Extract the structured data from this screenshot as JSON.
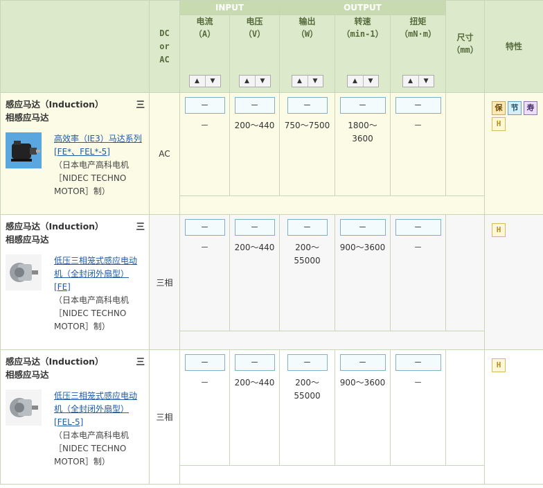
{
  "header": {
    "dc_ac": [
      "DC",
      "or",
      "AC"
    ],
    "input_group": "INPUT",
    "output_group": "OUTPUT",
    "columns": [
      {
        "name": "电流",
        "unit": "（A）"
      },
      {
        "name": "电压",
        "unit": "（V）"
      },
      {
        "name": "输出",
        "unit": "（W）"
      },
      {
        "name": "转速",
        "unit": "（min-1）"
      },
      {
        "name": "扭矩",
        "unit": "（mN·m）"
      }
    ],
    "size": {
      "name": "尺寸",
      "unit": "（mm）"
    },
    "features": "特性",
    "sort_up": "▲",
    "sort_down": "▼"
  },
  "rows": [
    {
      "category_a": "感应马达（Induction）",
      "category_b": "三",
      "category_c": "相感应马达",
      "product_link": "高效率（IE3）马达系列",
      "model_link": "[FE*、FEL*-5]",
      "maker": "（日本电产高科电机［NIDEC TECHNO MOTOR］制）",
      "dc_ac": "AC",
      "box": "－",
      "current": "－",
      "voltage": "200～440",
      "output": "750～7500",
      "speed": "1800～3600",
      "torque": "－",
      "badges": [
        "保",
        "节",
        "寿",
        "H"
      ]
    },
    {
      "category_a": "感应马达（Induction）",
      "category_b": "三",
      "category_c": "相感应马达",
      "product_link": "低压三相笼式感应电动机（全封闭外扇型）",
      "model_link": "[FE]",
      "maker": "（日本电产高科电机［NIDEC TECHNO MOTOR］制）",
      "dc_ac": "三相",
      "box": "－",
      "current": "－",
      "voltage": "200～440",
      "output": "200～55000",
      "speed": "900～3600",
      "torque": "－",
      "badges": [
        "H"
      ]
    },
    {
      "category_a": "感应马达（Induction）",
      "category_b": "三",
      "category_c": "相感应马达",
      "product_link": "低压三相笼式感应电动机（全封闭外扇型）",
      "model_link": "[FEL-5]",
      "maker": "（日本电产高科电机［NIDEC TECHNO MOTOR］制）",
      "dc_ac": "三相",
      "box": "－",
      "current": "－",
      "voltage": "200～440",
      "output": "200～55000",
      "speed": "900～3600",
      "torque": "－",
      "badges": [
        "H"
      ]
    }
  ],
  "colors": {
    "header_bg": "#dce9cb",
    "group_bg": "#c8dbb0",
    "link": "#1d5aa8",
    "row1_bg": "#fbfbe6"
  }
}
